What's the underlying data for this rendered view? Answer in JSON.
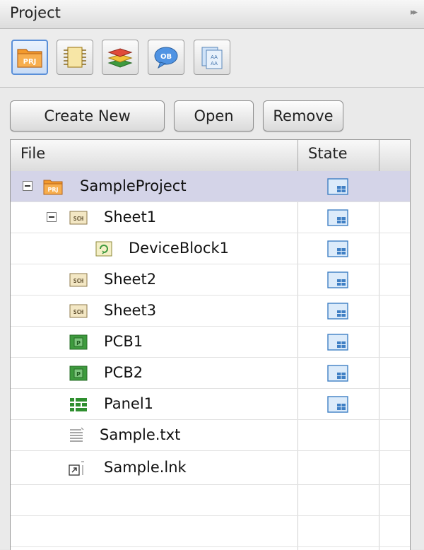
{
  "panel": {
    "title": "Project"
  },
  "toolbar": {
    "buttons": [
      {
        "icon": "project-icon",
        "label": "PRJ",
        "active": true
      },
      {
        "icon": "component-icon",
        "active": false
      },
      {
        "icon": "layers-icon",
        "active": false
      },
      {
        "icon": "object-icon",
        "label": "OB",
        "active": false
      },
      {
        "icon": "library-icon",
        "label": "AA",
        "active": false
      }
    ]
  },
  "actions": {
    "create_new": "Create New",
    "open": "Open",
    "remove": "Remove"
  },
  "table": {
    "columns": {
      "file": "File",
      "state": "State"
    },
    "rows": [
      {
        "name": "SampleProject",
        "type": "project",
        "icon_label": "PRJ",
        "level": 0,
        "expanded": true,
        "state_icon": "state-icon",
        "selected": true
      },
      {
        "name": "Sheet1",
        "type": "schematic",
        "icon_label": "SCH",
        "level": 1,
        "expanded": true,
        "state_icon": "state-icon"
      },
      {
        "name": "DeviceBlock1",
        "type": "device-block",
        "level": 2,
        "state_icon": "state-icon"
      },
      {
        "name": "Sheet2",
        "type": "schematic",
        "icon_label": "SCH",
        "level": 1,
        "state_icon": "state-icon"
      },
      {
        "name": "Sheet3",
        "type": "schematic",
        "icon_label": "SCH",
        "level": 1,
        "state_icon": "state-icon"
      },
      {
        "name": "PCB1",
        "type": "pcb",
        "icon_label": "P",
        "level": 1,
        "state_icon": "state-icon"
      },
      {
        "name": "PCB2",
        "type": "pcb",
        "icon_label": "P",
        "level": 1,
        "state_icon": "state-icon"
      },
      {
        "name": "Panel1",
        "type": "panel",
        "level": 1,
        "state_icon": "state-icon"
      },
      {
        "name": "Sample.txt",
        "type": "text-file",
        "level": 1
      },
      {
        "name": "Sample.lnk",
        "type": "link-file",
        "level": 1
      }
    ]
  },
  "colors": {
    "selected_row": "#d4d4e8",
    "accent": "#5a8fd8",
    "prj_orange": "#f39a2c",
    "pcb_green": "#3e9b3e"
  }
}
